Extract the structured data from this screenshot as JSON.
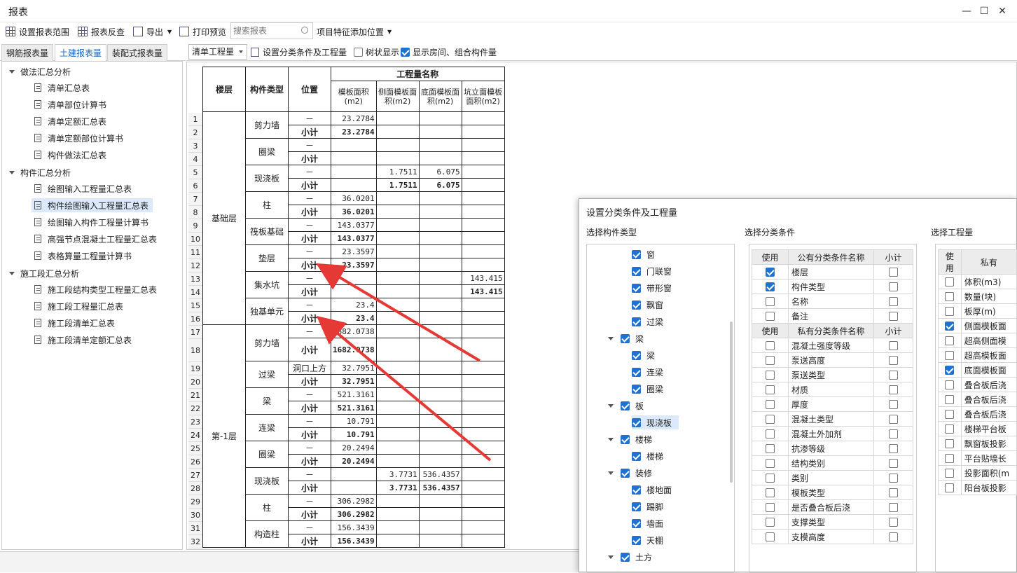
{
  "window": {
    "title": "报表"
  },
  "toolbar": {
    "set_range": "设置报表范围",
    "reverse": "报表反查",
    "export": "导出",
    "print_preview": "打印预览",
    "search_placeholder": "搜索报表",
    "feature_pos": "项目特征添加位置"
  },
  "tabs": [
    "钢筋报表量",
    "土建报表量",
    "装配式报表量"
  ],
  "tree": {
    "g1": "做法汇总分析",
    "g1_items": [
      "清单汇总表",
      "清单部位计算书",
      "清单定额汇总表",
      "清单定额部位计算书",
      "构件做法汇总表"
    ],
    "g2": "构件汇总分析",
    "g2_items": [
      "绘图输入工程量汇总表",
      "构件绘图输入工程量汇总表",
      "绘图输入构件工程量计算书",
      "高强节点混凝土工程量汇总表",
      "表格算量工程量计算书"
    ],
    "g3": "施工段汇总分析",
    "g3_items": [
      "施工段结构类型工程量汇总表",
      "施工段工程量汇总表",
      "施工段清单汇总表",
      "施工段清单定额汇总表"
    ]
  },
  "rtool": {
    "dropdown": "清单工程量",
    "set_cond": "设置分类条件及工程量",
    "tree_show": "树状显示",
    "show_room": "显示房间、组合构件量"
  },
  "report": {
    "h_floor": "楼层",
    "h_type": "构件类型",
    "h_pos": "位置",
    "h_group": "工程量名称",
    "h_cols": [
      "模板面积(m2)",
      "侧面模板面积(m2)",
      "底面模板面积(m2)",
      "坑立面模板面积(m2)"
    ],
    "dash": "－",
    "subtotal": "小计",
    "floors": [
      "基础层",
      "第-1层"
    ],
    "groups": [
      {
        "type": "剪力墙",
        "pos": "－",
        "v": [
          "23.2784",
          "",
          "",
          ""
        ],
        "s": [
          "23.2784",
          "",
          "",
          ""
        ]
      },
      {
        "type": "圈梁",
        "pos": "－",
        "v": [
          "",
          "",
          "",
          ""
        ],
        "s": [
          "",
          "",
          "",
          ""
        ]
      },
      {
        "type": "现浇板",
        "pos": "－",
        "v": [
          "",
          "1.7511",
          "6.075",
          ""
        ],
        "s": [
          "",
          "1.7511",
          "6.075",
          ""
        ]
      },
      {
        "type": "柱",
        "pos": "－",
        "v": [
          "36.0201",
          "",
          "",
          ""
        ],
        "s": [
          "36.0201",
          "",
          "",
          ""
        ]
      },
      {
        "type": "筏板基础",
        "pos": "－",
        "v": [
          "143.0377",
          "",
          "",
          ""
        ],
        "s": [
          "143.0377",
          "",
          "",
          ""
        ]
      },
      {
        "type": "垫层",
        "pos": "－",
        "v": [
          "23.3597",
          "",
          "",
          ""
        ],
        "s": [
          "23.3597",
          "",
          "",
          ""
        ]
      },
      {
        "type": "集水坑",
        "pos": "－",
        "v": [
          "",
          "",
          "",
          "143.415"
        ],
        "s": [
          "",
          "",
          "",
          "143.415"
        ]
      },
      {
        "type": "独基单元",
        "pos": "－",
        "v": [
          "23.4",
          "",
          "",
          ""
        ],
        "s": [
          "23.4",
          "",
          "",
          ""
        ]
      },
      {
        "type": "剪力墙",
        "pos": "－",
        "v": [
          "1682.0738",
          "",
          "",
          ""
        ],
        "s": [
          "1682.0738",
          "",
          "",
          ""
        ]
      },
      {
        "type": "过梁",
        "pos": "洞口上方",
        "v": [
          "32.7951",
          "",
          "",
          ""
        ],
        "s": [
          "32.7951",
          "",
          "",
          ""
        ]
      },
      {
        "type": "梁",
        "pos": "－",
        "v": [
          "521.3161",
          "",
          "",
          ""
        ],
        "s": [
          "521.3161",
          "",
          "",
          ""
        ]
      },
      {
        "type": "连梁",
        "pos": "－",
        "v": [
          "10.791",
          "",
          "",
          ""
        ],
        "s": [
          "10.791",
          "",
          "",
          ""
        ]
      },
      {
        "type": "圈梁",
        "pos": "－",
        "v": [
          "20.2494",
          "",
          "",
          ""
        ],
        "s": [
          "20.2494",
          "",
          "",
          ""
        ]
      },
      {
        "type": "现浇板",
        "pos": "－",
        "v": [
          "",
          "3.7731",
          "536.4357",
          ""
        ],
        "s": [
          "",
          "3.7731",
          "536.4357",
          ""
        ]
      },
      {
        "type": "柱",
        "pos": "－",
        "v": [
          "306.2982",
          "",
          "",
          ""
        ],
        "s": [
          "306.2982",
          "",
          "",
          ""
        ]
      },
      {
        "type": "构造柱",
        "pos": "－",
        "v": [
          "156.3439",
          "",
          "",
          ""
        ],
        "s": [
          "156.3439",
          "",
          "",
          ""
        ]
      }
    ]
  },
  "dialog": {
    "title": "设置分类条件及工程量",
    "sec_type": "选择构件类型",
    "sec_cond": "选择分类条件",
    "sec_qty": "选择工程量",
    "type_nodes": [
      {
        "label": "窗",
        "level": 2
      },
      {
        "label": "门联窗",
        "level": 2
      },
      {
        "label": "带形窗",
        "level": 2
      },
      {
        "label": "飘窗",
        "level": 2
      },
      {
        "label": "过梁",
        "level": 2
      },
      {
        "label": "梁",
        "level": 1
      },
      {
        "label": "梁",
        "level": 2
      },
      {
        "label": "连梁",
        "level": 2
      },
      {
        "label": "圈梁",
        "level": 2
      },
      {
        "label": "板",
        "level": 1
      },
      {
        "label": "现浇板",
        "level": 2
      },
      {
        "label": "楼梯",
        "level": 1
      },
      {
        "label": "楼梯",
        "level": 2
      },
      {
        "label": "装修",
        "level": 1
      },
      {
        "label": "楼地面",
        "level": 2
      },
      {
        "label": "踢脚",
        "level": 2
      },
      {
        "label": "墙面",
        "level": 2
      },
      {
        "label": "天棚",
        "level": 2
      },
      {
        "label": "土方",
        "level": 1
      }
    ],
    "cond_h_use": "使用",
    "cond_h_public": "公有分类条件名称",
    "cond_h_private": "私有分类条件名称",
    "cond_h_sub": "小计",
    "public_conds": [
      {
        "name": "楼层",
        "use": true
      },
      {
        "name": "构件类型",
        "use": true
      },
      {
        "name": "名称",
        "use": false
      },
      {
        "name": "备注",
        "use": false
      }
    ],
    "private_conds": [
      "混凝土强度等级",
      "泵送高度",
      "泵送类型",
      "材质",
      "厚度",
      "混凝土类型",
      "混凝土外加剂",
      "抗渗等级",
      "结构类别",
      "类别",
      "模板类型",
      "是否叠合板后浇",
      "支撑类型",
      "支模高度"
    ],
    "qty_h_use": "使用",
    "qty_h_name": "私有",
    "qty_items": [
      {
        "name": "体积(m3)",
        "use": false
      },
      {
        "name": "数量(块)",
        "use": false
      },
      {
        "name": "板厚(m)",
        "use": false
      },
      {
        "name": "侧面模板面",
        "use": true
      },
      {
        "name": "超高侧面模",
        "use": false
      },
      {
        "name": "超高模板面",
        "use": false
      },
      {
        "name": "底面模板面",
        "use": true
      },
      {
        "name": "叠合板后浇",
        "use": false
      },
      {
        "name": "叠合板后浇",
        "use": false
      },
      {
        "name": "叠合板后浇",
        "use": false
      },
      {
        "name": "楼梯平台板",
        "use": false
      },
      {
        "name": "飘窗板投影",
        "use": false
      },
      {
        "name": "平台贴墙长",
        "use": false
      },
      {
        "name": "投影面积(m",
        "use": false
      },
      {
        "name": "阳台板投影",
        "use": false
      }
    ]
  },
  "colors": {
    "accent": "#1e73d2",
    "arrow": "#e53935",
    "selection": "#dbe9fa"
  }
}
